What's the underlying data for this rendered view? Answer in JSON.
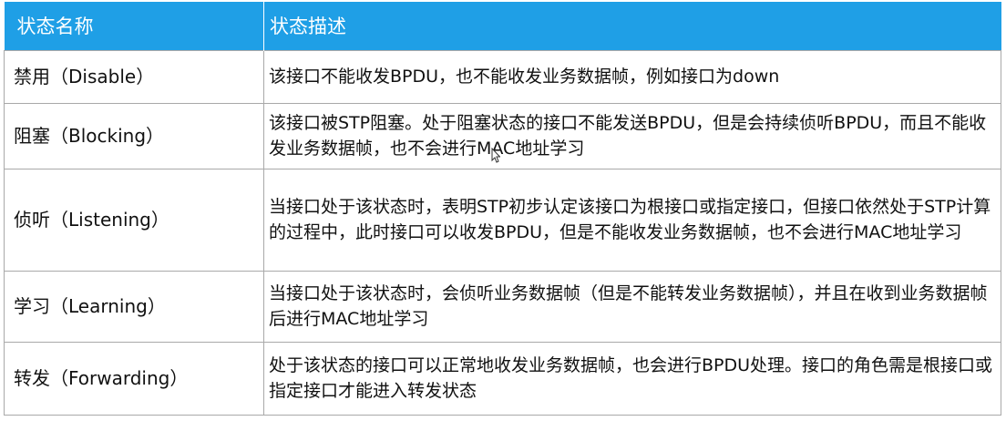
{
  "table": {
    "headers": [
      "状态名称",
      "状态描述"
    ],
    "rows": [
      {
        "name": "禁用（Disable）",
        "desc": "该接口不能收发BPDU，也不能收发业务数据帧，例如接口为down"
      },
      {
        "name": "阻塞（Blocking）",
        "desc": "该接口被STP阻塞。处于阻塞状态的接口不能发送BPDU，但是会持续侦听BPDU，而且不能收发业务数据帧，也不会进行MAC地址学习"
      },
      {
        "name": "侦听（Listening）",
        "desc": "当接口处于该状态时，表明STP初步认定该接口为根接口或指定接口，但接口依然处于STP计算的过程中，此时接口可以收发BPDU，但是不能收发业务数据帧，也不会进行MAC地址学习"
      },
      {
        "name": "学习（Learning）",
        "desc": "当接口处于该状态时，会侦听业务数据帧（但是不能转发业务数据帧），并且在收到业务数据帧后进行MAC地址学习"
      },
      {
        "name": "转发（Forwarding）",
        "desc": "处于该状态的接口可以正常地收发业务数据帧，也会进行BPDU处理。接口的角色需是根接口或指定接口才能进入转发状态"
      }
    ]
  },
  "colors": {
    "header_bg": "#1f9fe6",
    "header_text": "#ffffff",
    "border": "#a9a9a9",
    "text": "#111111"
  },
  "icons": {
    "cursor": "mouse-pointer-icon"
  }
}
